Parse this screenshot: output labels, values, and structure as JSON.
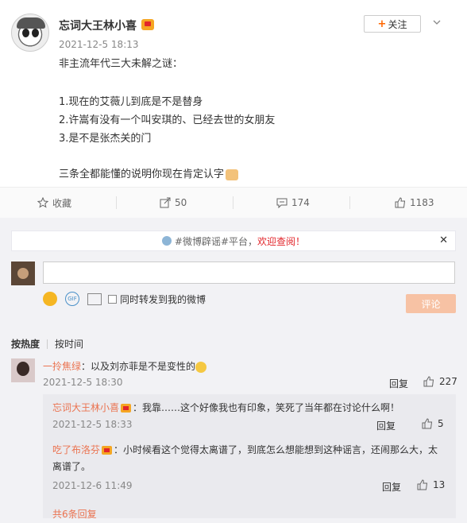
{
  "post": {
    "username": "忘词大王林小喜",
    "time": "2021-12-5 18:13",
    "follow_label": "关注",
    "lines": [
      "非主流年代三大未解之谜：",
      "",
      "1.现在的艾薇儿到底是不是替身",
      "2.许嵩有没有一个叫安琪的、已经去世的女朋友",
      "3.是不是张杰关的门",
      "",
      "三条全都能懂的说明你现在肯定认字"
    ]
  },
  "actions": {
    "favorite": "收藏",
    "repost": "50",
    "comment": "174",
    "like": "1183"
  },
  "notice": {
    "prefix": "#微博辟谣#平台，",
    "link": "欢迎查阅！"
  },
  "compose": {
    "sync_label": "同时转发到我的微博",
    "submit": "评论"
  },
  "sort": {
    "hot": "按热度",
    "time": "按时间"
  },
  "comment": {
    "name": "一拎焦绿",
    "text": "：以及刘亦菲是不是变性的",
    "time": "2021-12-5 18:30",
    "reply": "回复",
    "likes": "227"
  },
  "replies": [
    {
      "name": "忘词大王林小喜",
      "text": "：我靠……这个好像我也有印象，笑死了当年都在讨论什么啊！",
      "time": "2021-12-5 18:33",
      "reply": "回复",
      "likes": "5"
    },
    {
      "name": "吃了布洛芬",
      "text": "：小时候看这个觉得太离谱了，到底怎么想能想到这种谣言，还闹那么大，太",
      "text2": "离谱了。",
      "time": "2021-12-6 11:49",
      "reply": "回复",
      "likes": "13"
    }
  ],
  "more_replies": "共6条回复"
}
